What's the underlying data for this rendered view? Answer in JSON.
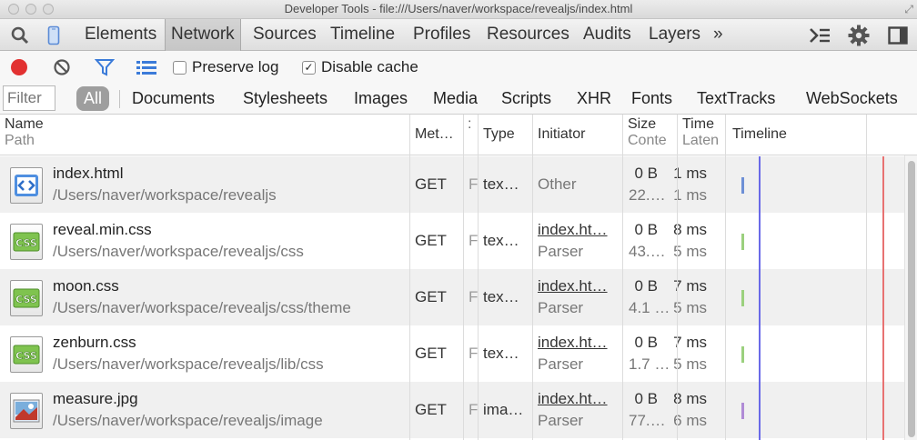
{
  "window": {
    "title": "Developer Tools - file:///Users/naver/workspace/revealjs/index.html"
  },
  "toolbar": {
    "tabs": [
      "Elements",
      "Network",
      "Sources",
      "Timeline",
      "Profiles",
      "Resources",
      "Audits",
      "Layers"
    ],
    "active_tab": "Network",
    "overflow": "»"
  },
  "controls": {
    "preserve_log": "Preserve log",
    "disable_cache": "Disable cache",
    "preserve_log_checked": false,
    "disable_cache_checked": true,
    "disable_cache_mark": "✓"
  },
  "filter": {
    "placeholder": "Filter",
    "all": "All",
    "types": [
      "Documents",
      "Stylesheets",
      "Images",
      "Media",
      "Scripts",
      "XHR",
      "Fonts",
      "TextTracks",
      "WebSockets"
    ]
  },
  "columns": {
    "name": "Name",
    "path": "Path",
    "method": "Met…",
    "status": ":",
    "type": "Type",
    "initiator": "Initiator",
    "size": "Size",
    "content": "Conte",
    "time": "Time",
    "latency": "Laten",
    "timeline": "Timeline"
  },
  "rows": [
    {
      "name": "index.html",
      "path": "/Users/naver/workspace/revealjs",
      "method": "GET",
      "status": "F",
      "type": "tex…",
      "initiator": "Other",
      "initiator_sub": "",
      "size": "0 B",
      "content": "22.…",
      "time": "1 ms",
      "latency": "1 ms",
      "icon": "html-file-icon",
      "bar_color": "#6d8fd6",
      "icon_label": "<>"
    },
    {
      "name": "reveal.min.css",
      "path": "/Users/naver/workspace/revealjs/css",
      "method": "GET",
      "status": "F",
      "type": "tex…",
      "initiator": "index.ht…",
      "initiator_sub": "Parser",
      "size": "0 B",
      "content": "43.…",
      "time": "8 ms",
      "latency": "5 ms",
      "icon": "css-file-icon",
      "bar_color": "#9bd07e",
      "icon_label": "CSS"
    },
    {
      "name": "moon.css",
      "path": "/Users/naver/workspace/revealjs/css/theme",
      "method": "GET",
      "status": "F",
      "type": "tex…",
      "initiator": "index.ht…",
      "initiator_sub": "Parser",
      "size": "0 B",
      "content": "4.1 …",
      "time": "7 ms",
      "latency": "5 ms",
      "icon": "css-file-icon",
      "bar_color": "#9bd07e",
      "icon_label": "CSS"
    },
    {
      "name": "zenburn.css",
      "path": "/Users/naver/workspace/revealjs/lib/css",
      "method": "GET",
      "status": "F",
      "type": "tex…",
      "initiator": "index.ht…",
      "initiator_sub": "Parser",
      "size": "0 B",
      "content": "1.7 …",
      "time": "7 ms",
      "latency": "5 ms",
      "icon": "css-file-icon",
      "bar_color": "#9bd07e",
      "icon_label": "CSS"
    },
    {
      "name": "measure.jpg",
      "path": "/Users/naver/workspace/revealjs/image",
      "method": "GET",
      "status": "F",
      "type": "ima…",
      "initiator": "index.ht…",
      "initiator_sub": "Parser",
      "size": "0 B",
      "content": "77.…",
      "time": "8 ms",
      "latency": "6 ms",
      "icon": "image-file-icon",
      "bar_color": "#b08bd6",
      "icon_label": ""
    }
  ],
  "colors": {
    "record": "#e23131",
    "dom_content_loaded": "#6a6ae8",
    "load": "#e87272"
  }
}
